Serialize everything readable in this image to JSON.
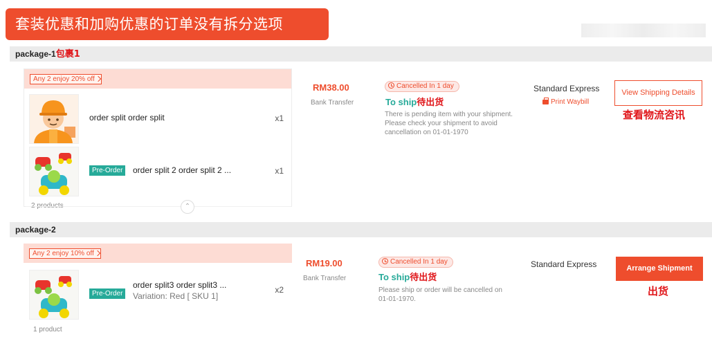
{
  "banner": {
    "text": "套装优惠和加购优惠的订单没有拆分选项"
  },
  "colors": {
    "accent": "#ee4d2d",
    "teal": "#26aa99",
    "annotation_red": "#e0161a"
  },
  "packages": [
    {
      "header_label": "package-1",
      "header_annotation": "包裹1",
      "promo_label": "Any 2 enjoy 20% off",
      "items": [
        {
          "name": "order split order split",
          "qty": "x1",
          "preorder": false,
          "thumb_icon": "worker-avatar-icon"
        },
        {
          "name": "order split 2 order split 2 ...",
          "qty": "x1",
          "preorder": true,
          "preorder_label": "Pre-Order",
          "thumb_icon": "toy-cars-icon"
        }
      ],
      "product_count": "2 products",
      "price": "RM38.00",
      "payment": "Bank Transfer",
      "cancel_badge": "Cancelled In 1 day",
      "status": "To ship",
      "status_annotation": "待出货",
      "note": "There is pending item with your shipment. Please check your shipment to avoid cancellation on 01-01-1970",
      "shipping_method": "Standard Express",
      "print_waybill": "Print Waybill",
      "action_button": "View Shipping Details",
      "action_annotation": "查看物流咨讯"
    },
    {
      "header_label": "package-2",
      "promo_label": "Any 2 enjoy 10% off",
      "items": [
        {
          "name": "order split3 order split3 ...",
          "variation": "Variation: Red [ SKU 1]",
          "qty": "x2",
          "preorder": true,
          "preorder_label": "Pre-Order",
          "thumb_icon": "toy-cars-icon"
        }
      ],
      "product_count": "1 product",
      "price": "RM19.00",
      "payment": "Bank Transfer",
      "cancel_badge": "Cancelled In 1 day",
      "status": "To ship",
      "status_annotation": "待出货",
      "note": "Please ship or order will be cancelled on 01-01-1970.",
      "shipping_method": "Standard Express",
      "action_button": "Arrange Shipment",
      "action_annotation": "出货"
    }
  ]
}
